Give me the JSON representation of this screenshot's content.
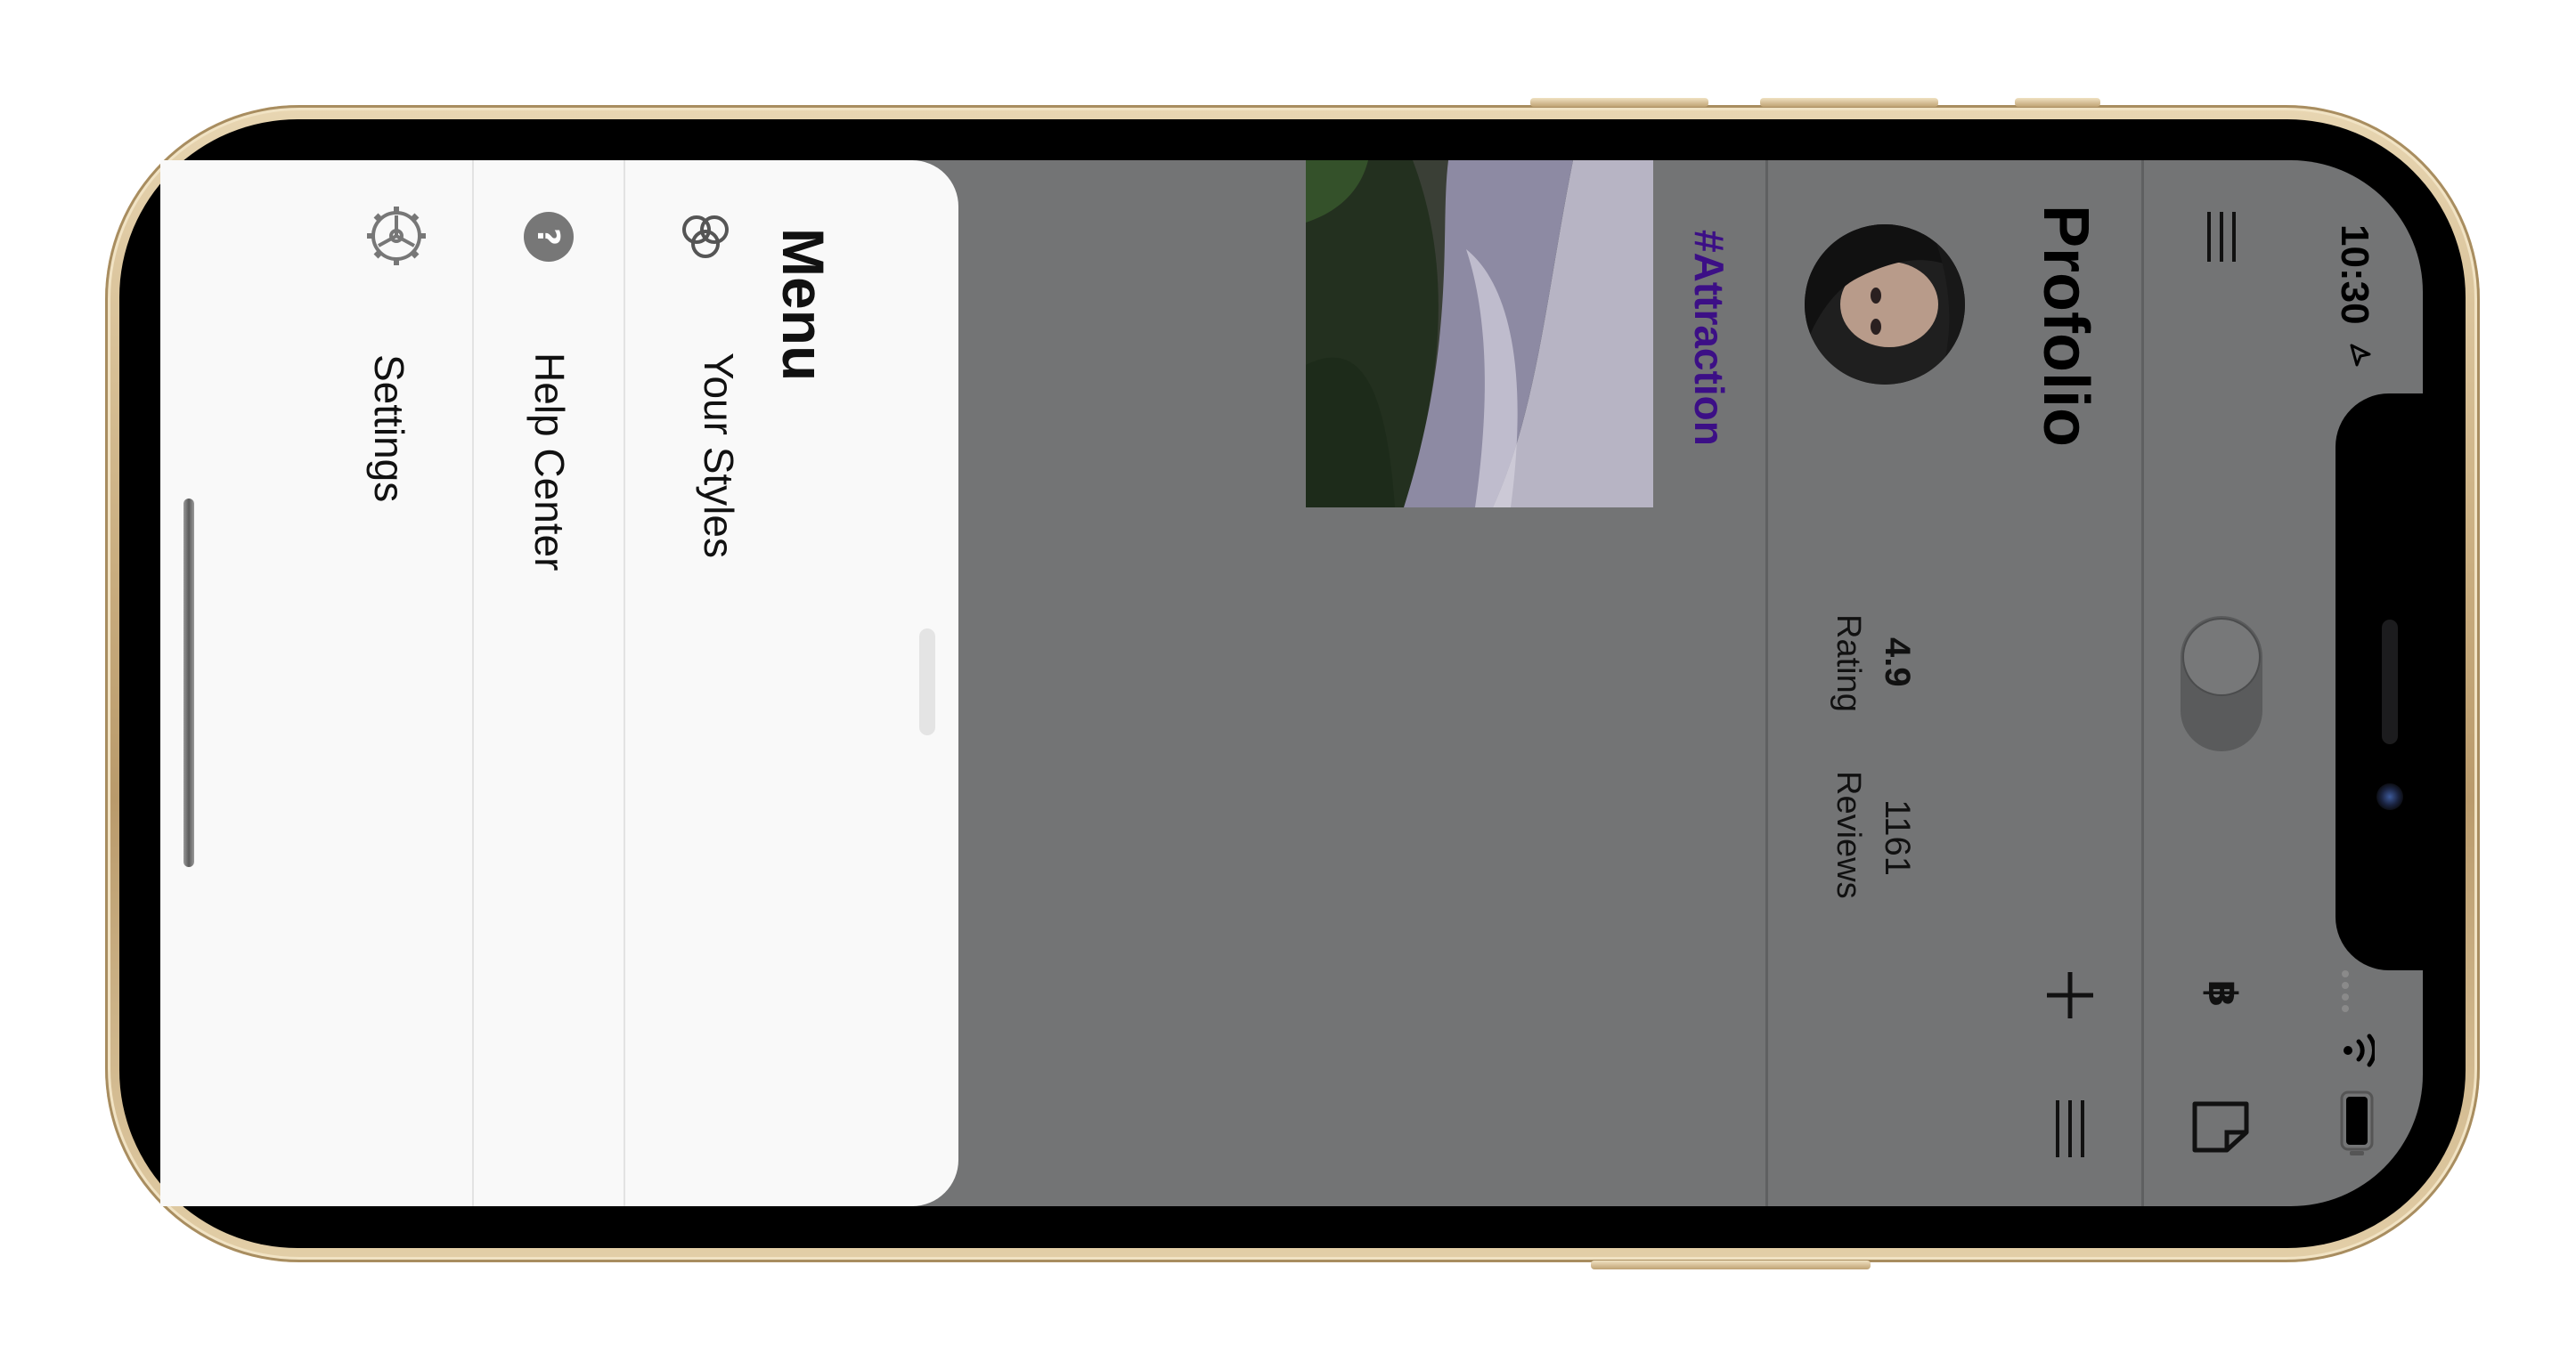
{
  "status_bar": {
    "time": "10:30"
  },
  "app": {
    "title": "Profolio",
    "tag": "#Attraction",
    "stats": [
      {
        "value": "4.9",
        "label": "Rating"
      },
      {
        "value": "1161",
        "label": "Reviews"
      }
    ],
    "icons": [
      "hamburger-icon",
      "toggle",
      "bitcoin-icon",
      "sticker-icon",
      "plus-icon",
      "list-icon"
    ]
  },
  "menu": {
    "title": "Menu",
    "items": [
      {
        "label": "Your Styles",
        "icon": "circles-icon"
      },
      {
        "label": "Help Center",
        "icon": "help-icon"
      },
      {
        "label": "Settings",
        "icon": "gear-icon"
      }
    ]
  },
  "colors": {
    "frame": "#c9ad7f",
    "drawer": "#f9f9f9",
    "dim_overlay": "#737475",
    "tag": "#3c0f86"
  }
}
